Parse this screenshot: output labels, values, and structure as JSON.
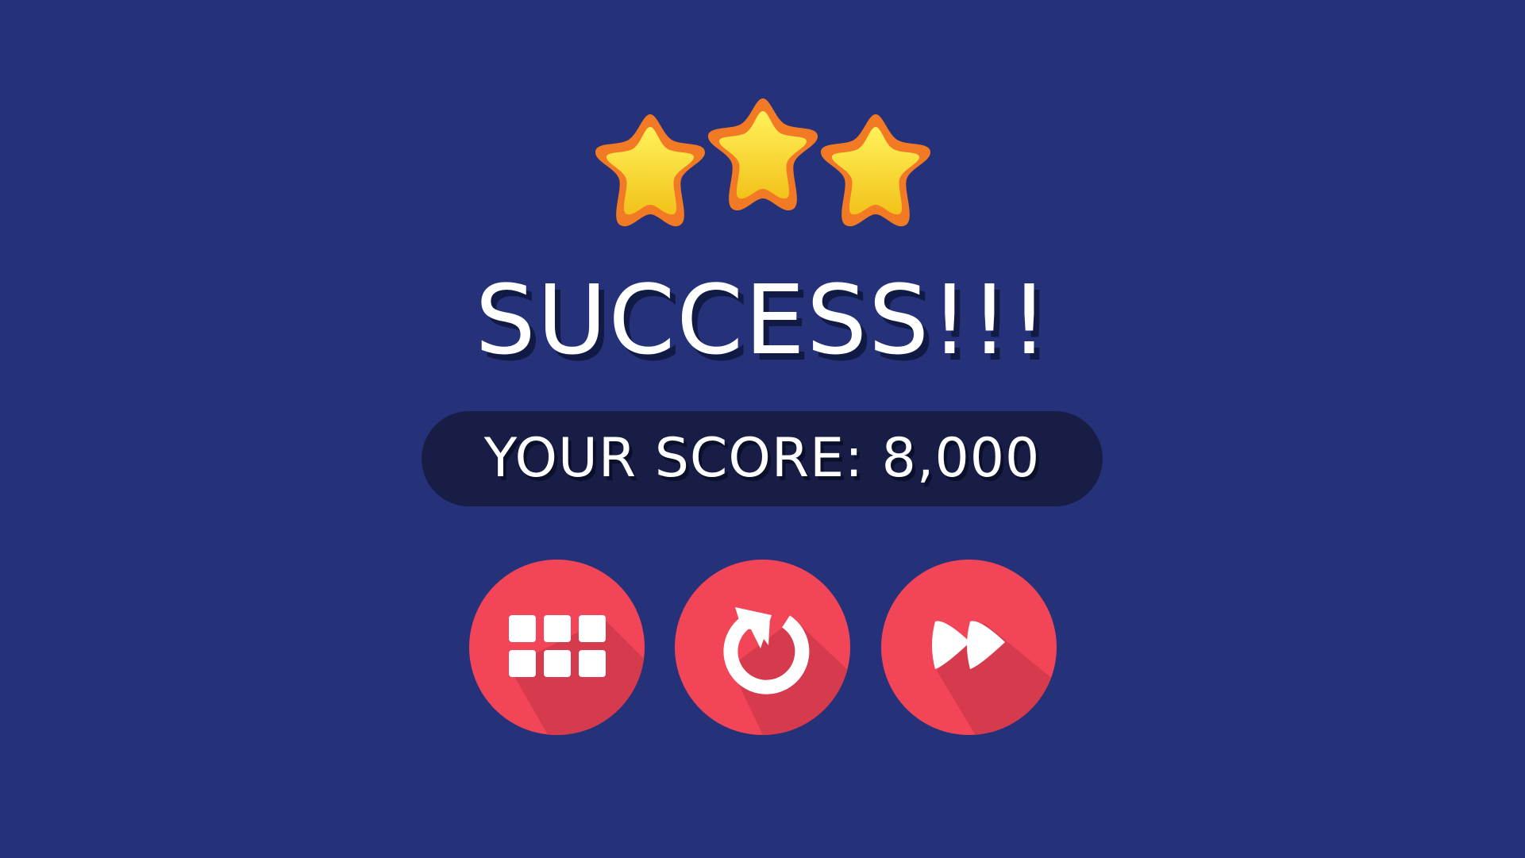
{
  "title": "SUCCESS!!!",
  "score": {
    "text": "YOUR SCORE: 8,000"
  },
  "rating": {
    "stars_earned": 3,
    "stars_total": 3
  },
  "buttons": [
    {
      "id": "menu",
      "icon": "grid-icon"
    },
    {
      "id": "replay",
      "icon": "replay-icon"
    },
    {
      "id": "next",
      "icon": "fast-forward-icon"
    }
  ],
  "colors": {
    "background": "#25327a",
    "score_pill": "#171d45",
    "button": "#f24558",
    "button_shadow": "#d63b4d",
    "star_fill_top": "#fff04a",
    "star_fill_bottom": "#f5c81a",
    "star_outline": "#f37a25",
    "text": "#ffffff"
  }
}
